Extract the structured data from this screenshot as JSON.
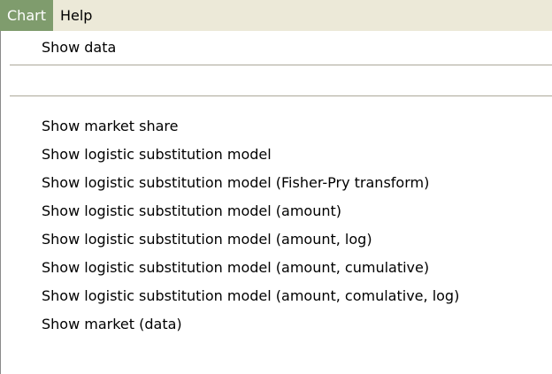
{
  "menubar": {
    "items": [
      {
        "label": "Chart",
        "active": true
      },
      {
        "label": "Help",
        "active": false
      }
    ]
  },
  "colors": {
    "menubar_bg": "#ece9d8",
    "menu_active_bg": "#7f9c6d",
    "menu_active_text": "#ffffff",
    "menu_bg": "#ffffff",
    "separator": "#aca899"
  },
  "chart_menu": {
    "show_data": "Show data",
    "items": [
      "Show market share",
      "Show logistic substitution model",
      "Show logistic substitution model (Fisher-Pry transform)",
      "Show logistic substitution model (amount)",
      "Show logistic substitution model (amount, log)",
      "Show logistic substitution model (amount, cumulative)",
      "Show logistic substitution model (amount, comulative, log)",
      "Show market (data)"
    ]
  }
}
